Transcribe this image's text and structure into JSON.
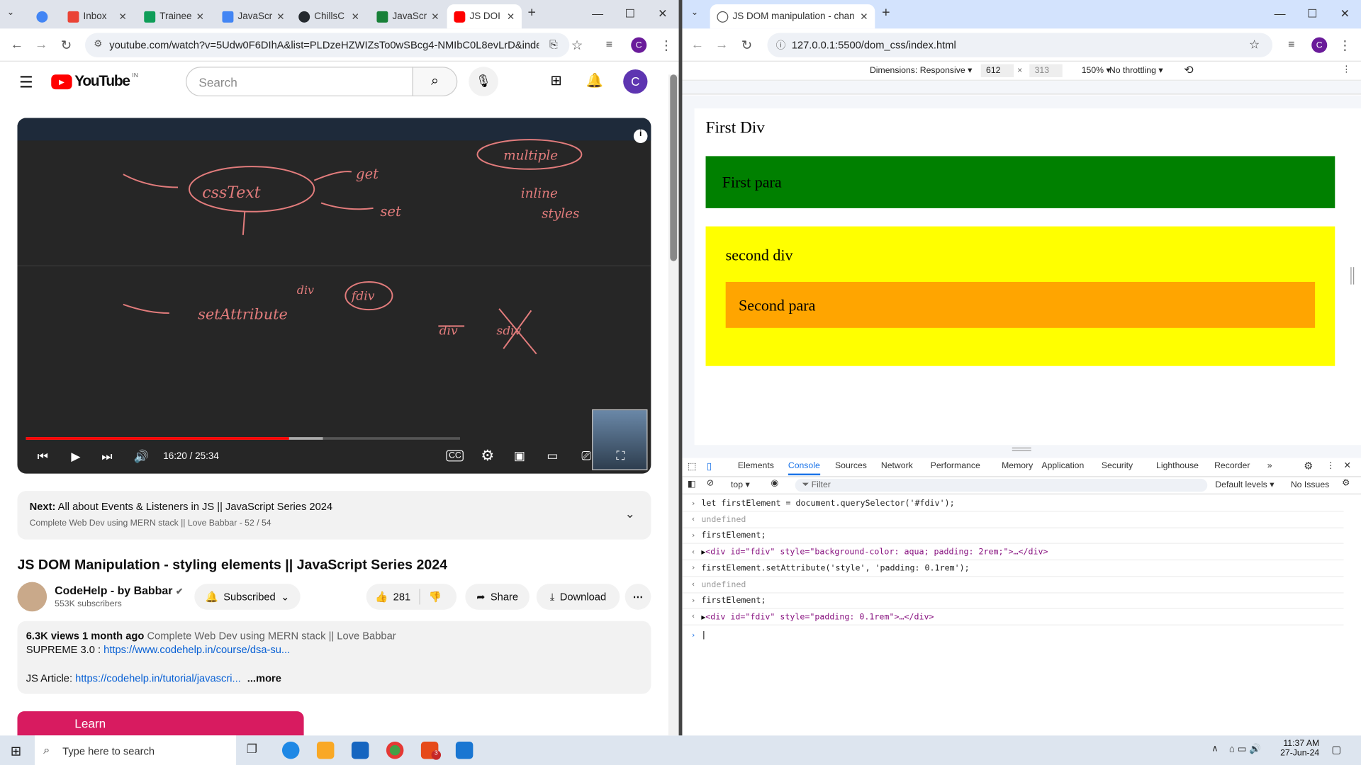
{
  "left_window": {
    "tabs": [
      {
        "label": "",
        "color": "#4285f4"
      },
      {
        "label": "Inbox",
        "color": "#ea4335"
      },
      {
        "label": "Trainee",
        "color": "#0f9d58"
      },
      {
        "label": "JavaScr",
        "color": "#4285f4"
      },
      {
        "label": "ChillsC",
        "color": "#24292e"
      },
      {
        "label": "JavaScr",
        "color": "#188038"
      },
      {
        "label": "JS DOI",
        "color": "#ff0000"
      }
    ],
    "url": "youtube.com/watch?v=5Udw0F6DIhA&list=PLDzeHZWIZsTo0wSBcg4-NMIbC0L8evLrD&index=52",
    "avatar_letter": "C"
  },
  "youtube": {
    "logo_text": "YouTube",
    "region": "IN",
    "search_placeholder": "Search",
    "avatar_letter": "C",
    "player": {
      "time": "16:20 / 25:34",
      "progress_fraction": 0.6375,
      "buffered_fraction": 0.72,
      "annotations": [
        "multiple",
        "get",
        "cssText",
        "inline",
        "set",
        "styles",
        "div",
        "fdiv",
        "setAttribute",
        "div",
        "sdiv"
      ]
    },
    "next": {
      "label": "Next:",
      "title": "All about Events & Listeners in JS || JavaScript Series 2024",
      "playlist": "Complete Web Dev using MERN stack || Love Babbar - 52 / 54"
    },
    "title": "JS DOM Manipulation - styling elements || JavaScript Series 2024",
    "channel": {
      "name": "CodeHelp - by Babbar",
      "subscribers": "553K subscribers"
    },
    "buttons": {
      "subscribed": "Subscribed",
      "likes": "281",
      "share": "Share",
      "download": "Download"
    },
    "description": {
      "views": "6.3K views",
      "age": "1 month ago",
      "playlist": "Complete Web Dev using MERN stack || Love Babbar",
      "supreme_label": "SUPREME 3.0 :",
      "supreme_link": "https://www.codehelp.in/course/dsa-su...",
      "article_label": "JS Article:",
      "article_link": "https://codehelp.in/tutorial/javascri...",
      "more": "...more"
    },
    "card_text": "Learn"
  },
  "right_window": {
    "tab_title": "JS DOM manipulation - changi",
    "url": "127.0.0.1:5500/dom_css/index.html",
    "avatar_letter": "C",
    "device_bar": {
      "dimensions": "Dimensions: Responsive",
      "width": "612",
      "height": "313",
      "zoom": "150%",
      "throttling": "No throttling"
    },
    "page": {
      "first_div": "First Div",
      "first_para": "First para",
      "second_div": "second div",
      "second_para": "Second para",
      "colors": {
        "first_para": "#008000",
        "second_div": "#ffff00",
        "second_para": "#ffa500"
      }
    },
    "devtools": {
      "tabs": [
        "Elements",
        "Console",
        "Sources",
        "Network",
        "Performance",
        "Memory",
        "Application",
        "Security",
        "Lighthouse",
        "Recorder"
      ],
      "active_tab": "Console",
      "context": "top",
      "filter_placeholder": "Filter",
      "levels": "Default levels",
      "issues": "No Issues",
      "console_lines": [
        {
          "type": "input",
          "text": "let firstElement = document.querySelector('#fdiv');"
        },
        {
          "type": "result",
          "text": "undefined"
        },
        {
          "type": "input",
          "text": "firstElement;"
        },
        {
          "type": "element",
          "text": "<div id=\"fdiv\" style=\"background-color: aqua; padding: 2rem;\">…</div>"
        },
        {
          "type": "input",
          "text": "firstElement.setAttribute('style', 'padding: 0.1rem');"
        },
        {
          "type": "result",
          "text": "undefined"
        },
        {
          "type": "input",
          "text": "firstElement;"
        },
        {
          "type": "element",
          "text": "<div id=\"fdiv\" style=\"padding: 0.1rem\">…</div>"
        }
      ]
    }
  },
  "taskbar": {
    "search_placeholder": "Type here to search",
    "time": "11:37 AM",
    "date": "27-Jun-24",
    "badge": "3"
  }
}
